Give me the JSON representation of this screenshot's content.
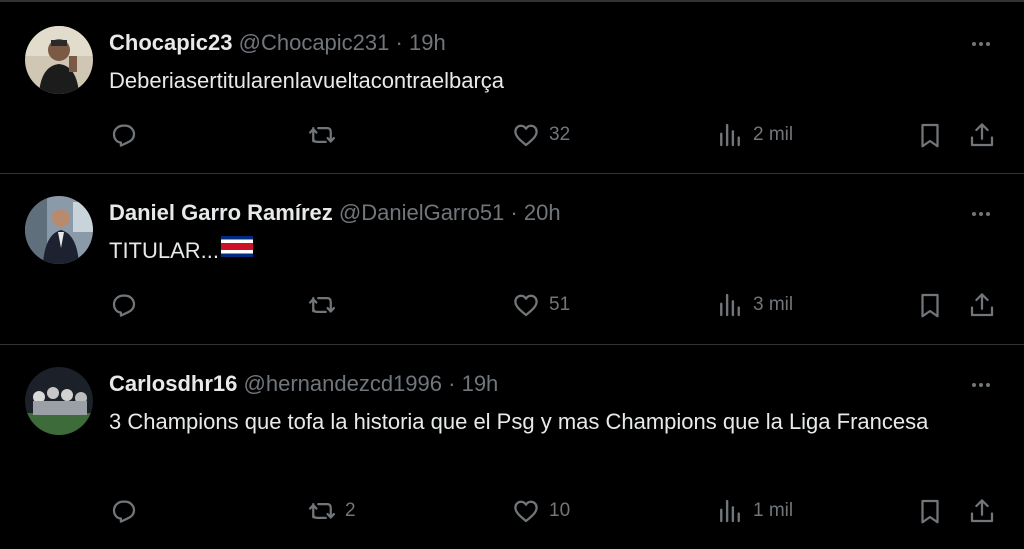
{
  "colors": {
    "background": "#000000",
    "divider": "#2f3336",
    "primary_text": "#e7e9ea",
    "secondary_text": "#71767b"
  },
  "tweets": [
    {
      "display_name": "Chocapic23",
      "handle": "@Chocapic231",
      "separator": "·",
      "time": "19h",
      "text": "Deberiasertitularenlavueltacontraelbarça",
      "replies": "",
      "retweets": "",
      "likes": "32",
      "views": "2 mil",
      "icons": [
        "more-icon",
        "reply-icon",
        "retweet-icon",
        "like-icon",
        "views-icon",
        "bookmark-icon",
        "share-icon"
      ]
    },
    {
      "display_name": "Daniel Garro Ramírez",
      "handle": "@DanielGarro51",
      "separator": "·",
      "time": "20h",
      "text": "TITULAR...",
      "emoji": "costa-rica-flag",
      "replies": "",
      "retweets": "",
      "likes": "51",
      "views": "3 mil"
    },
    {
      "display_name": "Carlosdhr16",
      "handle": "@hernandezcd1996",
      "separator": "·",
      "time": "19h",
      "text": "3 Champions que tofa la historia que el Psg y mas Champions que la Liga Francesa",
      "replies": "",
      "retweets": "2",
      "likes": "10",
      "views": "1 mil"
    }
  ]
}
